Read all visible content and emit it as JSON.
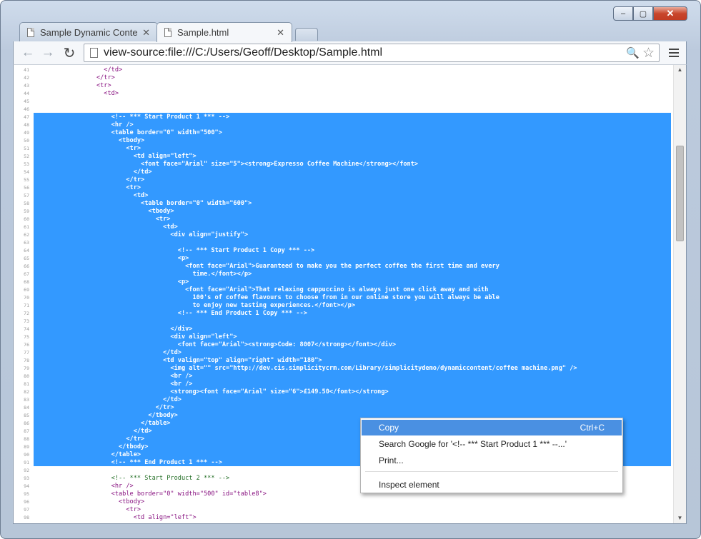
{
  "window": {
    "caption_min": "–",
    "caption_max": "▢",
    "caption_close": "✕"
  },
  "tabs": [
    {
      "title": "Sample Dynamic Content",
      "close": "✕"
    },
    {
      "title": "Sample.html",
      "close": "✕"
    }
  ],
  "toolbar": {
    "back_glyph": "←",
    "forward_glyph": "→",
    "reload_glyph": "↻",
    "url": "view-source:file:///C:/Users/Geoff/Desktop/Sample.html",
    "zoom_glyph": "🔍",
    "star_glyph": "☆"
  },
  "source_lines": [
    {
      "n": "41",
      "t": "                   </td>"
    },
    {
      "n": "42",
      "t": "                 </tr>"
    },
    {
      "n": "43",
      "t": "                 <tr>"
    },
    {
      "n": "44",
      "t": "                   <td>"
    },
    {
      "n": "45",
      "t": ""
    },
    {
      "n": "46",
      "t": ""
    },
    {
      "n": "47",
      "t": "                     <!-- *** Start Product 1 *** -->"
    },
    {
      "n": "48",
      "t": "                     <hr />"
    },
    {
      "n": "49",
      "t": "                     <table border=\"0\" width=\"500\">"
    },
    {
      "n": "50",
      "t": "                       <tbody>"
    },
    {
      "n": "51",
      "t": "                         <tr>"
    },
    {
      "n": "52",
      "t": "                           <td align=\"left\">"
    },
    {
      "n": "53",
      "t": "                             <font face=\"Arial\" size=\"5\"><strong>Expresso Coffee Machine</strong></font>"
    },
    {
      "n": "54",
      "t": "                           </td>"
    },
    {
      "n": "55",
      "t": "                         </tr>"
    },
    {
      "n": "56",
      "t": "                         <tr>"
    },
    {
      "n": "57",
      "t": "                           <td>"
    },
    {
      "n": "58",
      "t": "                             <table border=\"0\" width=\"600\">"
    },
    {
      "n": "59",
      "t": "                               <tbody>"
    },
    {
      "n": "60",
      "t": "                                 <tr>"
    },
    {
      "n": "61",
      "t": "                                   <td>"
    },
    {
      "n": "62",
      "t": "                                     <div align=\"justify\">"
    },
    {
      "n": "63",
      "t": ""
    },
    {
      "n": "64",
      "t": "                                       <!-- *** Start Product 1 Copy *** -->"
    },
    {
      "n": "65",
      "t": "                                       <p>"
    },
    {
      "n": "66",
      "t": "                                         <font face=\"Arial\">Guaranteed to make you the perfect coffee the first time and every"
    },
    {
      "n": "67",
      "t": "                                           time.</font></p>"
    },
    {
      "n": "68",
      "t": "                                       <p>"
    },
    {
      "n": "69",
      "t": "                                         <font face=\"Arial\">That relaxing cappuccino is always just one click away and with"
    },
    {
      "n": "70",
      "t": "                                           100's of coffee flavours to choose from in our online store you will always be able"
    },
    {
      "n": "71",
      "t": "                                           to enjoy new tasting experiences.</font></p>"
    },
    {
      "n": "72",
      "t": "                                       <!-- *** End Product 1 Copy *** -->"
    },
    {
      "n": "73",
      "t": ""
    },
    {
      "n": "74",
      "t": "                                     </div>"
    },
    {
      "n": "75",
      "t": "                                     <div align=\"left\">"
    },
    {
      "n": "76",
      "t": "                                       <font face=\"Arial\"><strong>Code: 8007</strong></font></div>"
    },
    {
      "n": "77",
      "t": "                                   </td>"
    },
    {
      "n": "78",
      "t": "                                   <td valign=\"top\" align=\"right\" width=\"180\">"
    },
    {
      "n": "79",
      "t": "                                     <img alt=\"\" src=\"http://dev.cis.simplicitycrm.com/Library/simplicitydemo/dynamiccontent/coffee machine.png\" />"
    },
    {
      "n": "80",
      "t": "                                     <br />"
    },
    {
      "n": "81",
      "t": "                                     <br />"
    },
    {
      "n": "82",
      "t": "                                     <strong><font face=\"Arial\" size=\"6\">£149.50</font></strong>"
    },
    {
      "n": "83",
      "t": "                                   </td>"
    },
    {
      "n": "84",
      "t": "                                 </tr>"
    },
    {
      "n": "85",
      "t": "                               </tbody>"
    },
    {
      "n": "86",
      "t": "                             </table>"
    },
    {
      "n": "87",
      "t": "                           </td>"
    },
    {
      "n": "88",
      "t": "                         </tr>"
    },
    {
      "n": "89",
      "t": "                       </tbody>"
    },
    {
      "n": "90",
      "t": "                     </table>"
    },
    {
      "n": "91",
      "t": "                     <!-- *** End Product 1 *** -->"
    },
    {
      "n": "92",
      "t": ""
    },
    {
      "n": "93",
      "t": "                     <!-- *** Start Product 2 *** -->"
    },
    {
      "n": "94",
      "t": "                     <hr />"
    },
    {
      "n": "95",
      "t": "                     <table border=\"0\" width=\"500\" id=\"table8\">"
    },
    {
      "n": "96",
      "t": "                       <tbody>"
    },
    {
      "n": "97",
      "t": "                         <tr>"
    },
    {
      "n": "98",
      "t": "                           <td align=\"left\">"
    }
  ],
  "context_menu": {
    "copy_label": "Copy",
    "copy_shortcut": "Ctrl+C",
    "search_label": "Search Google for '<!-- *** Start Product 1 *** --...'",
    "print_label": "Print...",
    "inspect_label": "Inspect element"
  },
  "scrollbar": {
    "up_glyph": "▲",
    "down_glyph": "▼"
  },
  "colors": {
    "selection": "#3399ff",
    "menu_highlight": "#4a90e2",
    "tag": "#881280",
    "comment": "#236e25"
  }
}
